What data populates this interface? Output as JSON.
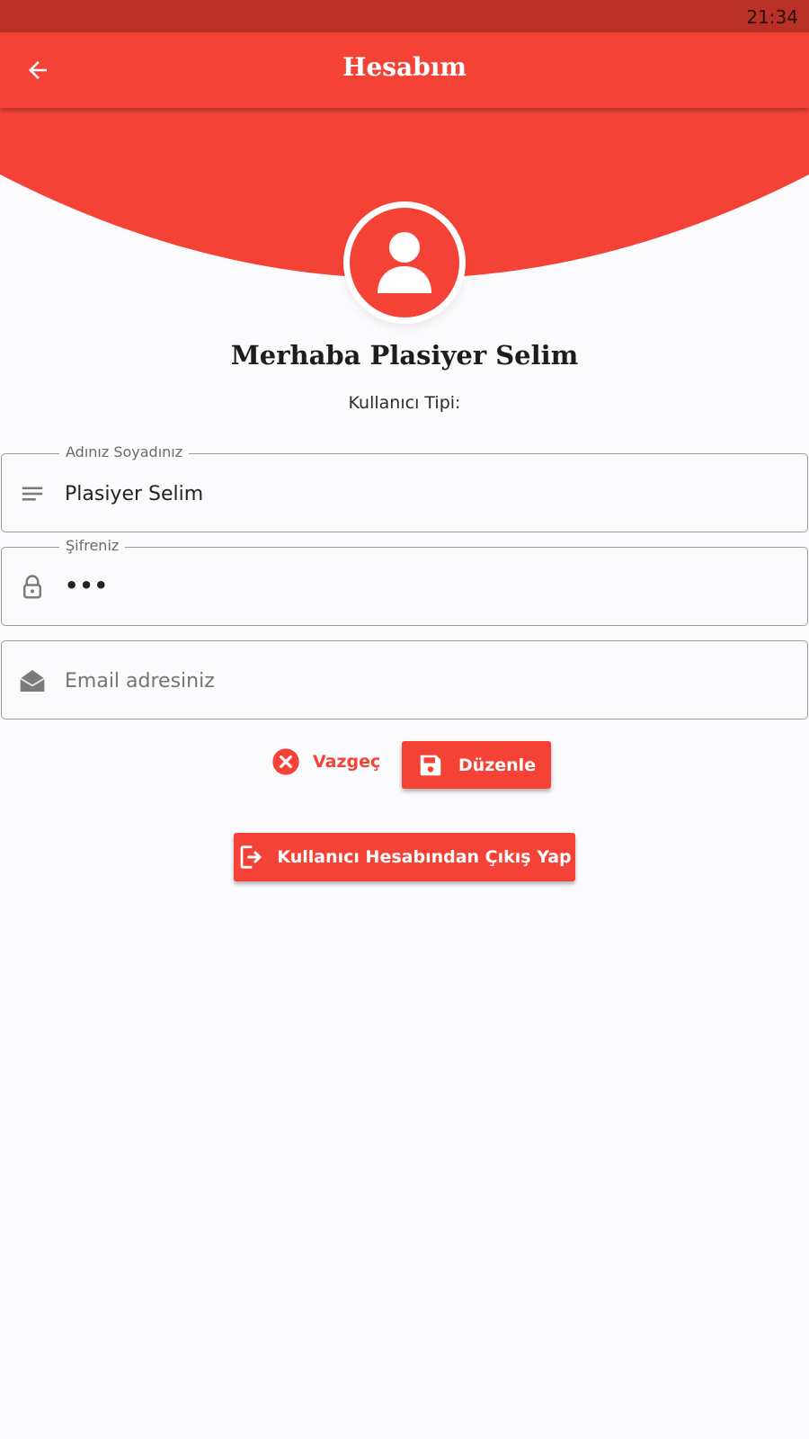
{
  "status_bar": {
    "time": "21:34"
  },
  "app_bar": {
    "title": "Hesabım",
    "back_icon": "arrow-back-icon"
  },
  "profile": {
    "avatar_icon": "person-icon",
    "greeting": "Merhaba Plasiyer Selim",
    "user_type_label": "Kullanıcı Tipi:"
  },
  "form": {
    "name_field": {
      "label": "Adınız Soyadınız",
      "value": "Plasiyer Selim",
      "icon": "subject-icon"
    },
    "password_field": {
      "label": "Şifreniz",
      "value": "•••",
      "icon": "lock-icon"
    },
    "email_field": {
      "label": "",
      "value": "",
      "placeholder": "Email adresiniz",
      "icon": "mail-icon"
    }
  },
  "actions": {
    "cancel_label": "Vazgeç",
    "save_label": "Düzenle",
    "logout_label": "Kullanıcı Hesabından Çıkış Yap"
  },
  "colors": {
    "primary": "#f44336",
    "status_bar": "#b93026",
    "background": "#fbfbfd"
  }
}
